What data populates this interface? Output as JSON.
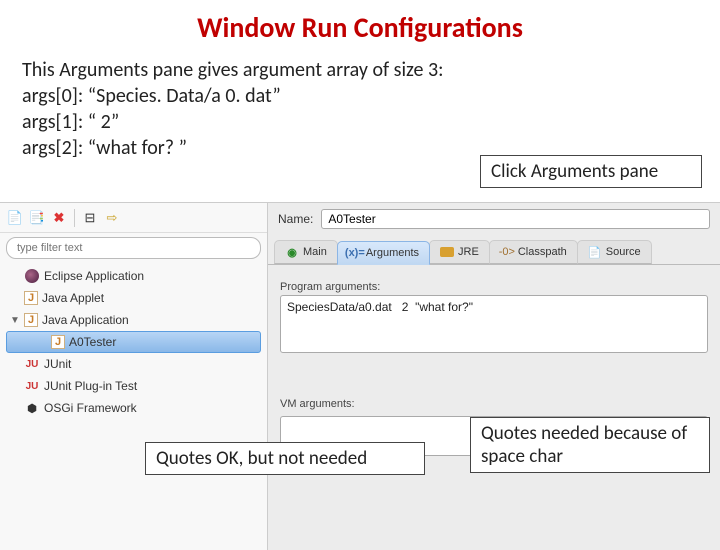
{
  "title": "Window Run Configurations",
  "intro": {
    "line1": "This Arguments pane gives argument array of size 3:",
    "line2": "args[0]: “Species. Data/a 0. dat”",
    "line3": "args[1]: “ 2”",
    "line4": "args[2]: “what for? ”"
  },
  "callouts": {
    "c1": "Click Arguments pane",
    "c2": "Quotes OK, but not needed",
    "c3": "Quotes needed because of space char"
  },
  "toolbar": {
    "new_label": "new",
    "dup_label": "duplicate",
    "del_label": "delete",
    "collapse_label": "collapse",
    "link_label": "link"
  },
  "filter": {
    "placeholder": "type filter text"
  },
  "tree": {
    "eclipse": "Eclipse Application",
    "applet": "Java Applet",
    "javaapp": "Java Application",
    "a0tester": "A0Tester",
    "junit": "JUnit",
    "junitplug": "JUnit Plug-in Test",
    "osgi": "OSGi Framework"
  },
  "config": {
    "name_label": "Name:",
    "name_value": "A0Tester"
  },
  "tabs": {
    "main": "Main",
    "args": "Arguments",
    "jre": "JRE",
    "classpath": "Classpath",
    "source": "Source"
  },
  "panel": {
    "progargs_label": "Program arguments:",
    "progargs_value": "SpeciesData/a0.dat   2  \"what for?\"",
    "vmargs_label": "VM arguments:"
  }
}
